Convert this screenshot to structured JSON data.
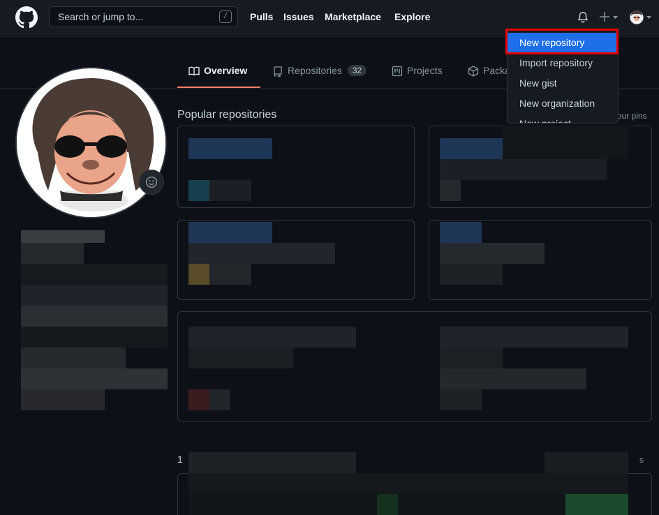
{
  "header": {
    "search_placeholder": "Search or jump to...",
    "search_shortcut": "/",
    "nav": [
      "Pulls",
      "Issues",
      "Marketplace",
      "Explore"
    ]
  },
  "tabs": {
    "overview": "Overview",
    "repositories": "Repositories",
    "repositories_count": "32",
    "projects": "Projects",
    "packages": "Packa"
  },
  "main": {
    "popular_title": "Popular repositories",
    "customize_pins": "our pins",
    "contrib_fragment": "1",
    "contrib_menu": "s"
  },
  "dropdown": {
    "items": [
      "New repository",
      "Import repository",
      "New gist",
      "New organization",
      "New project"
    ]
  },
  "colors": {
    "accent": "#1f6feb",
    "highlight": "#e50000",
    "tab_underline": "#f78166"
  }
}
